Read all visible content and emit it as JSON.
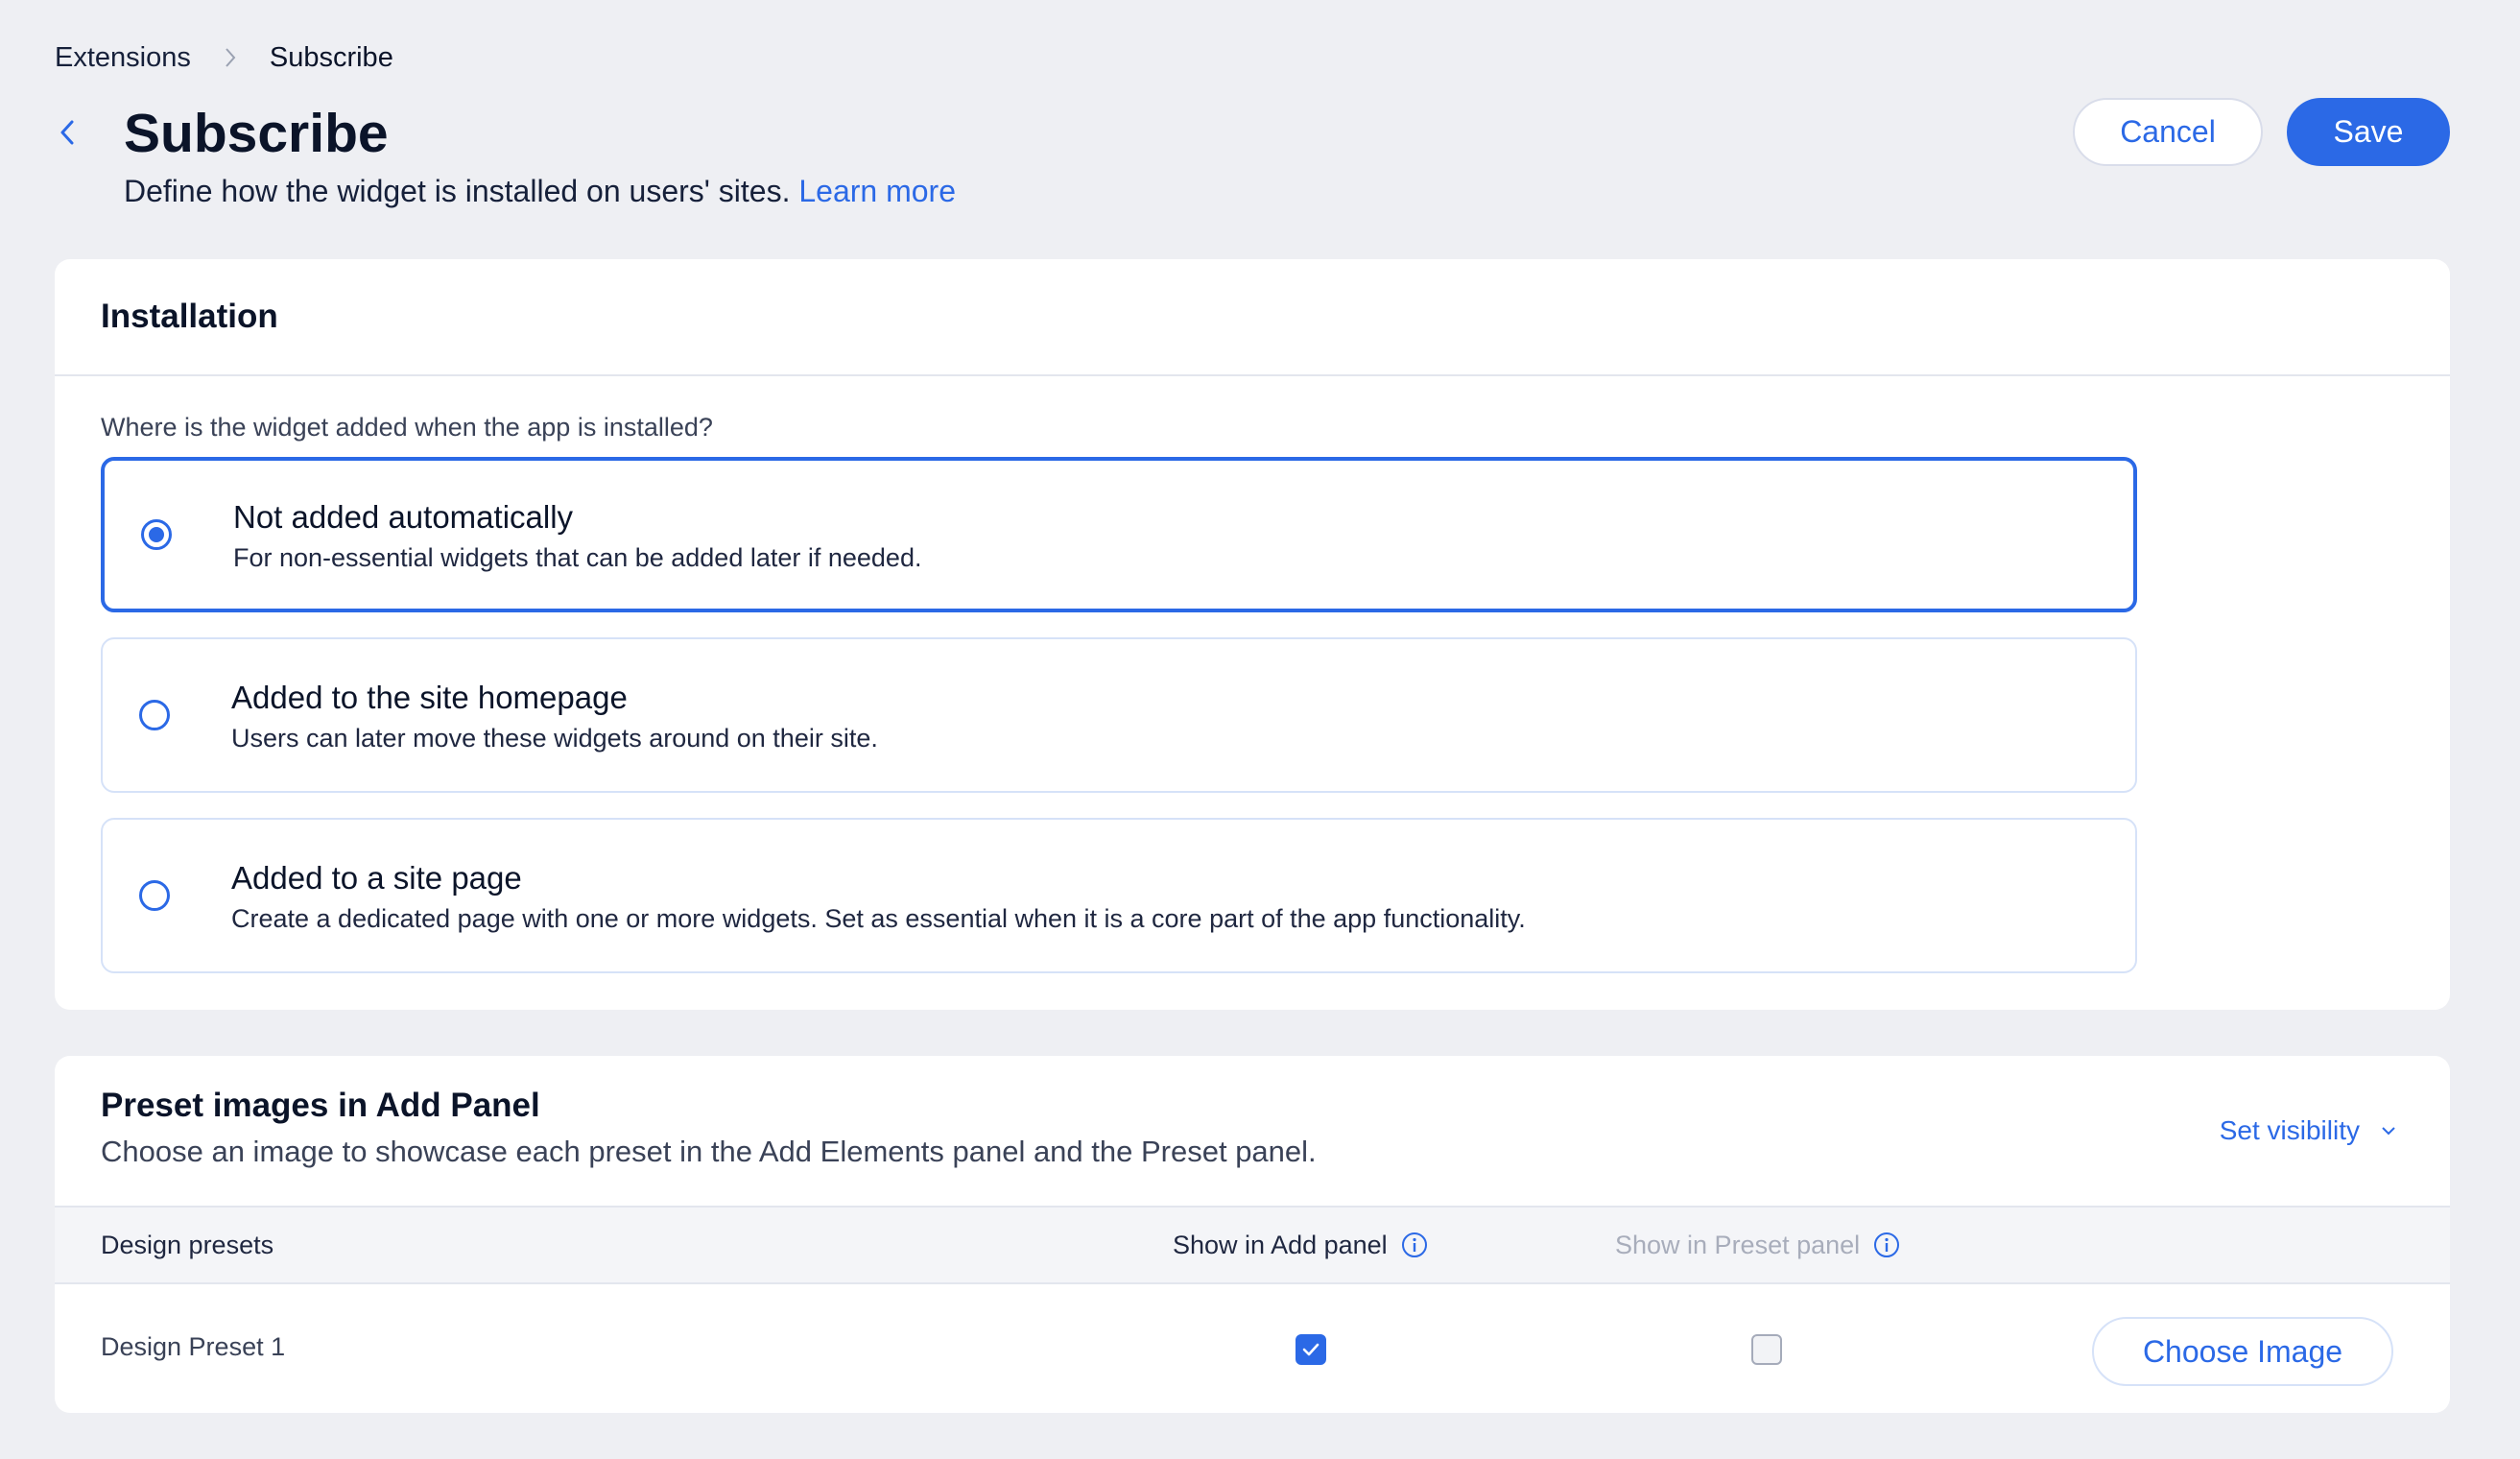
{
  "breadcrumb": {
    "parent": "Extensions",
    "current": "Subscribe"
  },
  "header": {
    "title": "Subscribe",
    "subtitle": "Define how the widget is installed on users' sites.",
    "learn_more": "Learn more",
    "cancel_label": "Cancel",
    "save_label": "Save"
  },
  "installation": {
    "title": "Installation",
    "question": "Where is the widget added when the app is installed?",
    "selected_option": "not_added",
    "options": [
      {
        "id": "not_added",
        "title": "Not added automatically",
        "desc": "For non-essential widgets that can be added later if needed.",
        "selected": true
      },
      {
        "id": "homepage",
        "title": "Added to the site homepage",
        "desc": "Users can later move these widgets around on their site.",
        "selected": false
      },
      {
        "id": "site_page",
        "title": "Added to a site page",
        "desc": "Create a dedicated page with one or more widgets. Set as essential when it is a core part of the app functionality.",
        "selected": false
      }
    ]
  },
  "preset": {
    "title": "Preset images in Add Panel",
    "desc": "Choose an image to showcase each preset in the Add Elements panel and the Preset panel.",
    "visibility_label": "Set visibility",
    "columns": {
      "design_presets": "Design presets",
      "show_add": "Show in Add panel",
      "show_preset": "Show in Preset panel"
    },
    "rows": [
      {
        "name": "Design Preset 1",
        "show_in_add_panel": true,
        "show_in_preset_panel": false,
        "choose_label": "Choose Image"
      }
    ]
  },
  "icons": [
    "chevron-right-icon",
    "chevron-left-icon",
    "info-icon",
    "chevron-down-icon",
    "check-icon"
  ],
  "colors": {
    "accent": "#2b69e6",
    "background": "#eeeff3",
    "card": "#ffffff",
    "text": "#16203a"
  }
}
